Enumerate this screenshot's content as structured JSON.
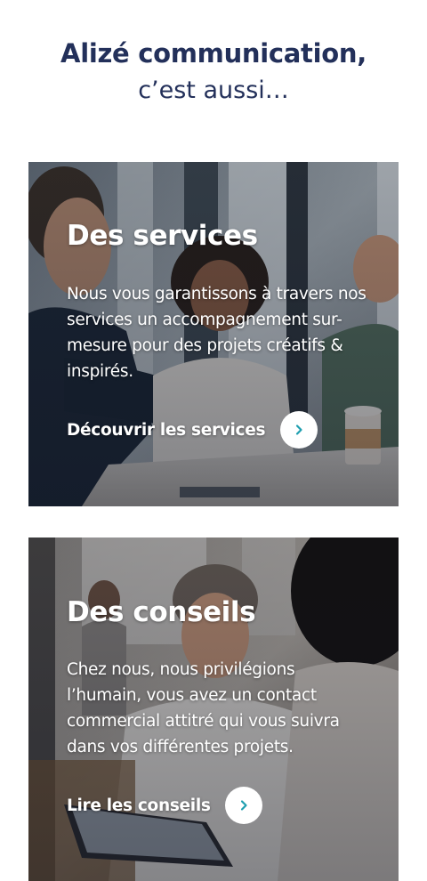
{
  "heading": {
    "line1": "Alizé communication,",
    "line2": "c’est aussi…"
  },
  "cards": [
    {
      "title": "Des services",
      "text": "Nous vous garantissons à travers nos services un accompagnement sur-mesure pour des projets créatifs & inspirés.",
      "link_label": "Découvrir les services",
      "icon": "chevron-right-icon"
    },
    {
      "title": "Des conseils",
      "text": "Chez nous, nous privilégions l’humain, vous avez un contact commercial attitré qui vous suivra dans vos différentes projets.",
      "link_label": "Lire les conseils",
      "icon": "chevron-right-icon"
    }
  ],
  "colors": {
    "heading": "#23305a",
    "arrow": "#1f9fb0",
    "card_text": "#ffffff"
  }
}
